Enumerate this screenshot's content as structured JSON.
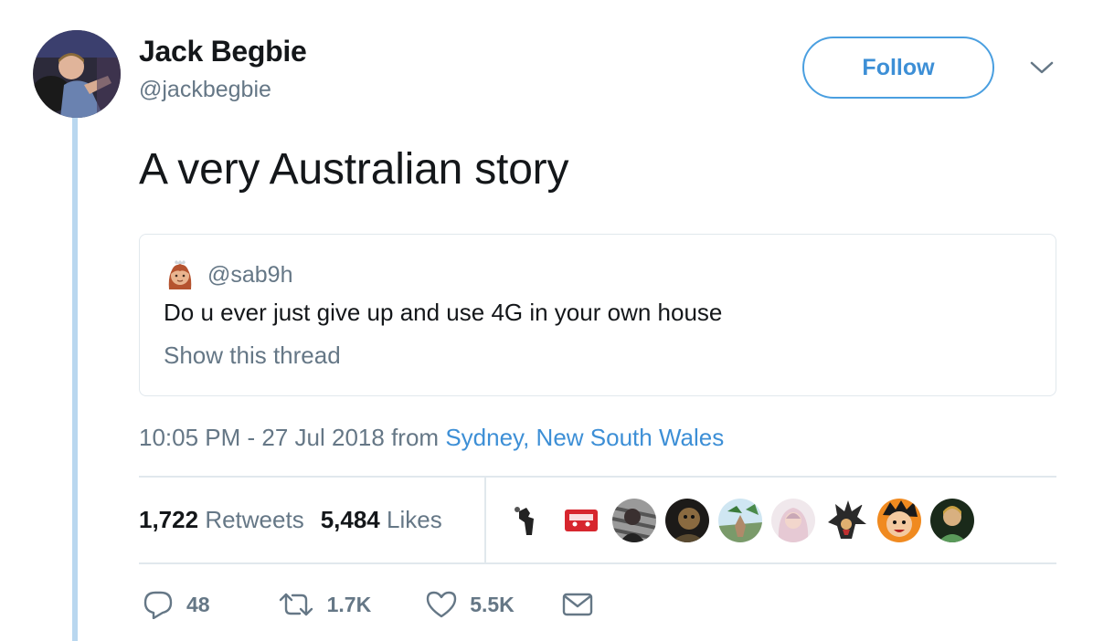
{
  "tweet": {
    "author": {
      "name": "Jack Begbie",
      "handle": "@jackbegbie"
    },
    "follow_label": "Follow",
    "text": "A very Australian story",
    "quoted": {
      "handle": "@sab9h",
      "text": "Do u ever just give up and use 4G in your own house",
      "show_thread": "Show this thread"
    },
    "timestamp": "10:05 PM - 27 Jul 2018",
    "from_label": "from",
    "location": "Sydney, New South Wales",
    "stats": {
      "retweets_count": "1,722",
      "retweets_label": "Retweets",
      "likes_count": "5,484",
      "likes_label": "Likes"
    },
    "liker_avatars": [
      "liker-avatar-1",
      "liker-avatar-2",
      "liker-avatar-3",
      "liker-avatar-4",
      "liker-avatar-5",
      "liker-avatar-6",
      "liker-avatar-7",
      "liker-avatar-8",
      "liker-avatar-9"
    ],
    "actions": {
      "reply_count": "48",
      "retweet_count": "1.7K",
      "like_count": "5.5K"
    }
  },
  "colors": {
    "link": "#3d8fd6",
    "secondary_text": "#657786",
    "thread_line": "#b9d7ef",
    "border": "#e1e8ed"
  },
  "icons": [
    "chevron-down-icon",
    "reply-icon",
    "retweet-icon",
    "heart-icon",
    "mail-icon",
    "woman-emoji-icon"
  ]
}
